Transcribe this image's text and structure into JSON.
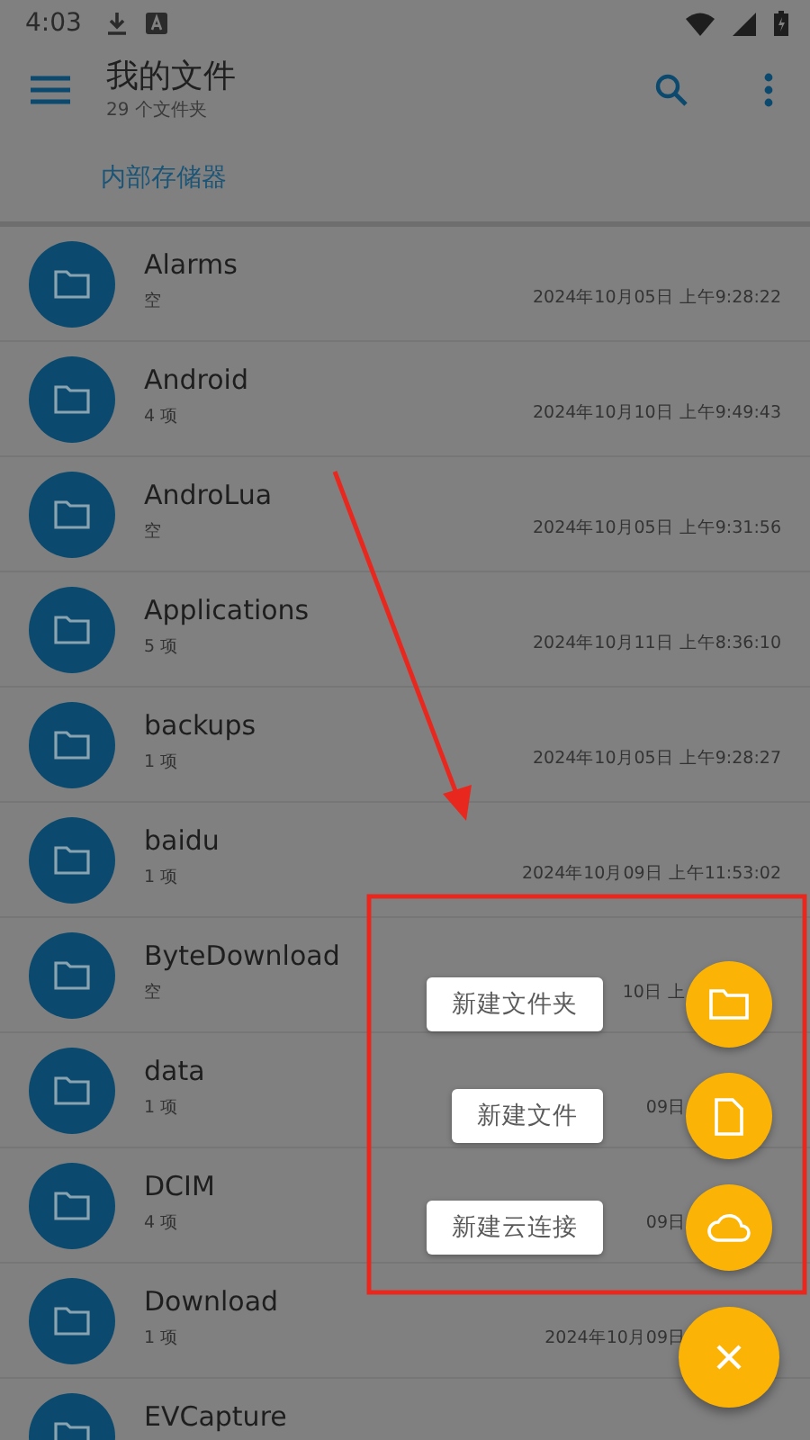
{
  "status_bar": {
    "time": "4:03"
  },
  "app_bar": {
    "title": "我的文件",
    "subtitle": "29 个文件夹"
  },
  "breadcrumb": "内部存储器",
  "files": [
    {
      "name": "Alarms",
      "info": "空",
      "date": "2024年10月05日 上午9:28:22"
    },
    {
      "name": "Android",
      "info": "4 项",
      "date": "2024年10月10日 上午9:49:43"
    },
    {
      "name": "AndroLua",
      "info": "空",
      "date": "2024年10月05日 上午9:31:56"
    },
    {
      "name": "Applications",
      "info": "5 项",
      "date": "2024年10月11日 上午8:36:10"
    },
    {
      "name": "backups",
      "info": "1 项",
      "date": "2024年10月05日 上午9:28:27"
    },
    {
      "name": "baidu",
      "info": "1 项",
      "date": "2024年10月09日 上午11:53:02"
    },
    {
      "name": "ByteDownload",
      "info": "空",
      "partial_date": "10日 上"
    },
    {
      "name": "data",
      "info": "1 项",
      "partial_date": "09日"
    },
    {
      "name": "DCIM",
      "info": "4 项",
      "partial_date": "09日"
    },
    {
      "name": "Download",
      "info": "1 项",
      "partial_date": "2024年10月09日"
    },
    {
      "name": "EVCapture"
    }
  ],
  "fab_menu": [
    {
      "label": "新建文件夹",
      "kind": "folder"
    },
    {
      "label": "新建文件",
      "kind": "file"
    },
    {
      "label": "新建云连接",
      "kind": "cloud"
    }
  ]
}
